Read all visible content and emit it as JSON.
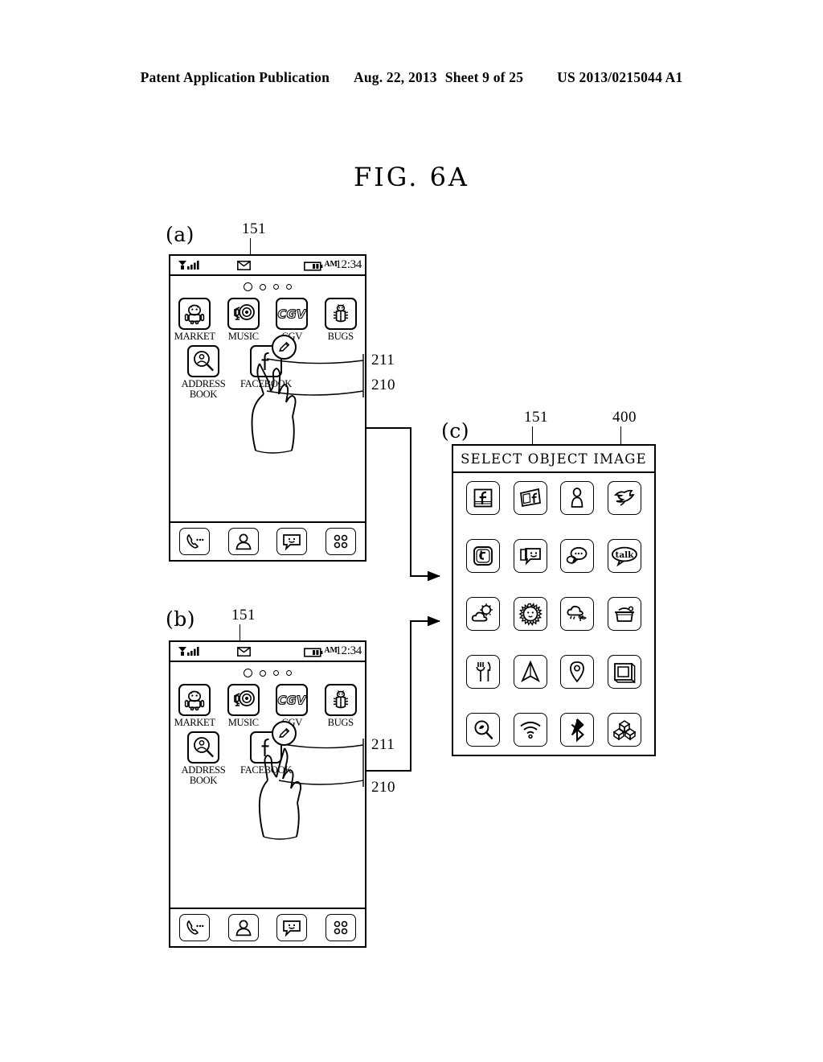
{
  "header": {
    "publication": "Patent Application Publication",
    "date": "Aug. 22, 2013",
    "sheet": "Sheet 9 of 25",
    "patent_number": "US 2013/0215044 A1"
  },
  "figure": {
    "title": "FIG.  6A"
  },
  "panels": {
    "a": {
      "letter": "(a)",
      "ref_display": "151",
      "ref_item_211": "211",
      "ref_item_210": "210"
    },
    "b": {
      "letter": "(b)",
      "ref_display": "151",
      "ref_item_211": "211",
      "ref_item_210": "210"
    },
    "c": {
      "letter": "(c)",
      "ref_display": "151",
      "ref_window": "400",
      "title": "SELECT OBJECT IMAGE"
    }
  },
  "phone": {
    "status_bar": {
      "signal_icon": "signal-bars-icon",
      "mail_icon": "envelope-icon",
      "battery_icon": "battery-icon",
      "meridiem": "AM",
      "time": "12:34"
    },
    "page_dots": [
      {
        "name": "page-dot-active"
      },
      {
        "name": "page-dot"
      },
      {
        "name": "page-dot"
      },
      {
        "name": "page-dot"
      }
    ],
    "apps_row1": [
      {
        "label": "MARKET",
        "icon": "android-robot-icon"
      },
      {
        "label": "MUSIC",
        "icon": "speaker-mic-icon"
      },
      {
        "label": "CGV",
        "icon": "cgv-logo-icon"
      },
      {
        "label": "BUGS",
        "icon": "beetle-icon"
      }
    ],
    "apps_row2": [
      {
        "label": "ADDRESS\nBOOK",
        "icon": "person-magnifier-icon"
      },
      {
        "label": "FACEBOOK",
        "icon": "facebook-f-icon",
        "badge": "pencil-edit-icon"
      }
    ],
    "dock": [
      {
        "icon": "phone-handset-icon"
      },
      {
        "icon": "contact-person-icon"
      },
      {
        "icon": "smiley-message-icon"
      },
      {
        "icon": "app-drawer-grid-icon"
      }
    ]
  },
  "selector_icons": [
    [
      {
        "name": "facebook-framed-icon"
      },
      {
        "name": "facebook-card-icon"
      },
      {
        "name": "person-silhouette-icon"
      },
      {
        "name": "twitter-bird-icon"
      }
    ],
    [
      {
        "name": "twitter-t-icon"
      },
      {
        "name": "smiley-chat-icon"
      },
      {
        "name": "chat-bubbles-icon"
      },
      {
        "name": "talk-bubble-icon",
        "text": "talk"
      }
    ],
    [
      {
        "name": "sun-cloud-weather-icon"
      },
      {
        "name": "sun-face-icon"
      },
      {
        "name": "cloud-rain-plant-icon"
      },
      {
        "name": "cooking-pot-icon"
      }
    ],
    [
      {
        "name": "fork-knife-icon"
      },
      {
        "name": "navigation-arrow-icon"
      },
      {
        "name": "map-pin-icon"
      },
      {
        "name": "picture-frame-icon"
      }
    ],
    [
      {
        "name": "search-magnifier-icon"
      },
      {
        "name": "wifi-icon"
      },
      {
        "name": "bluetooth-icon"
      },
      {
        "name": "cubes-3d-icon"
      }
    ]
  ]
}
